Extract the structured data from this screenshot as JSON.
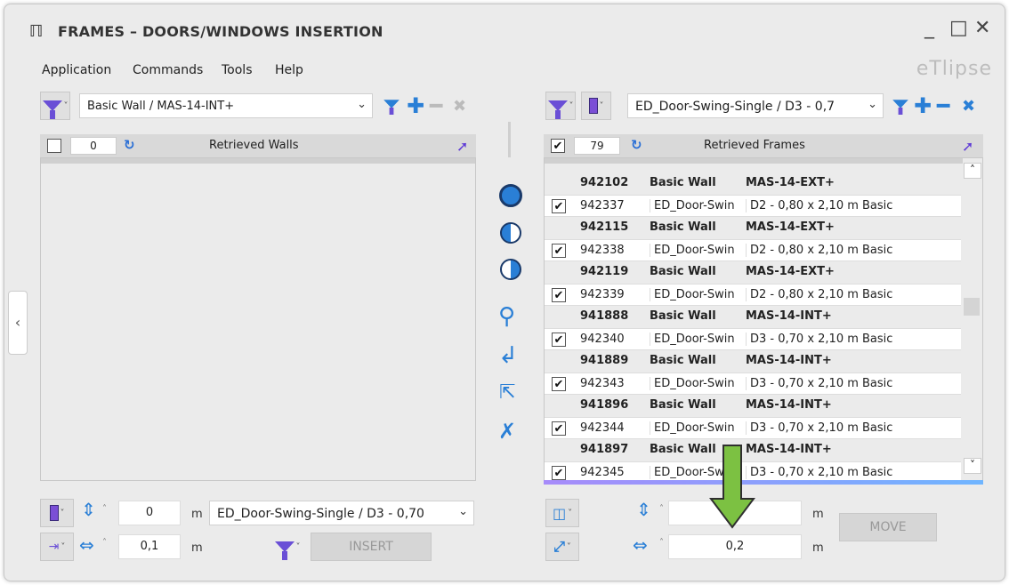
{
  "window": {
    "title": "FRAMES – DOORS/WINDOWS INSERTION",
    "minimize": "_",
    "maximize": "□",
    "close": "✕",
    "brand": "eTlipse"
  },
  "menu": [
    "Application",
    "Commands",
    "Tools",
    "Help"
  ],
  "left": {
    "filter_value": "Basic Wall / MAS-14-INT+",
    "count": "0",
    "header": "Retrieved Walls"
  },
  "right": {
    "filter_value": "ED_Door-Swing-Single / D3 - 0,7",
    "count": "79",
    "header": "Retrieved Frames"
  },
  "rows": [
    {
      "id": "942102",
      "type": "Basic Wall",
      "name": "MAS-14-EXT+",
      "group": true
    },
    {
      "id": "942337",
      "type": "ED_Door-Swin",
      "name": "D2 - 0,80 x 2,10 m Basic",
      "group": false
    },
    {
      "id": "942115",
      "type": "Basic Wall",
      "name": "MAS-14-EXT+",
      "group": true
    },
    {
      "id": "942338",
      "type": "ED_Door-Swin",
      "name": "D2 - 0,80 x 2,10 m Basic",
      "group": false
    },
    {
      "id": "942119",
      "type": "Basic Wall",
      "name": "MAS-14-EXT+",
      "group": true
    },
    {
      "id": "942339",
      "type": "ED_Door-Swin",
      "name": "D2 - 0,80 x 2,10 m Basic",
      "group": false
    },
    {
      "id": "941888",
      "type": "Basic Wall",
      "name": "MAS-14-INT+",
      "group": true
    },
    {
      "id": "942340",
      "type": "ED_Door-Swin",
      "name": "D3 - 0,70 x 2,10 m Basic",
      "group": false
    },
    {
      "id": "941889",
      "type": "Basic Wall",
      "name": "MAS-14-INT+",
      "group": true
    },
    {
      "id": "942343",
      "type": "ED_Door-Swin",
      "name": "D3 - 0,70 x 2,10 m Basic",
      "group": false
    },
    {
      "id": "941896",
      "type": "Basic Wall",
      "name": "MAS-14-INT+",
      "group": true
    },
    {
      "id": "942344",
      "type": "ED_Door-Swin",
      "name": "D3 - 0,70 x 2,10 m Basic",
      "group": false
    },
    {
      "id": "941897",
      "type": "Basic Wall",
      "name": "MAS-14-INT+",
      "group": true
    },
    {
      "id": "942345",
      "type": "ED_Door-Swin",
      "name": "D3 - 0,70 x 2,10 m Basic",
      "group": false
    }
  ],
  "bottom_left": {
    "vert_value": "0",
    "horiz_value": "0,1",
    "unit": "m",
    "door_type": "ED_Door-Swing-Single / D3 - 0,70",
    "insert_label": "INSERT"
  },
  "bottom_right": {
    "vert_value": "",
    "horiz_value": "0,2",
    "unit": "m",
    "move_label": "MOVE"
  },
  "colors": {
    "accent": "#6a4fd6",
    "blue": "#2a7fd6",
    "arrow": "#7cc142"
  }
}
